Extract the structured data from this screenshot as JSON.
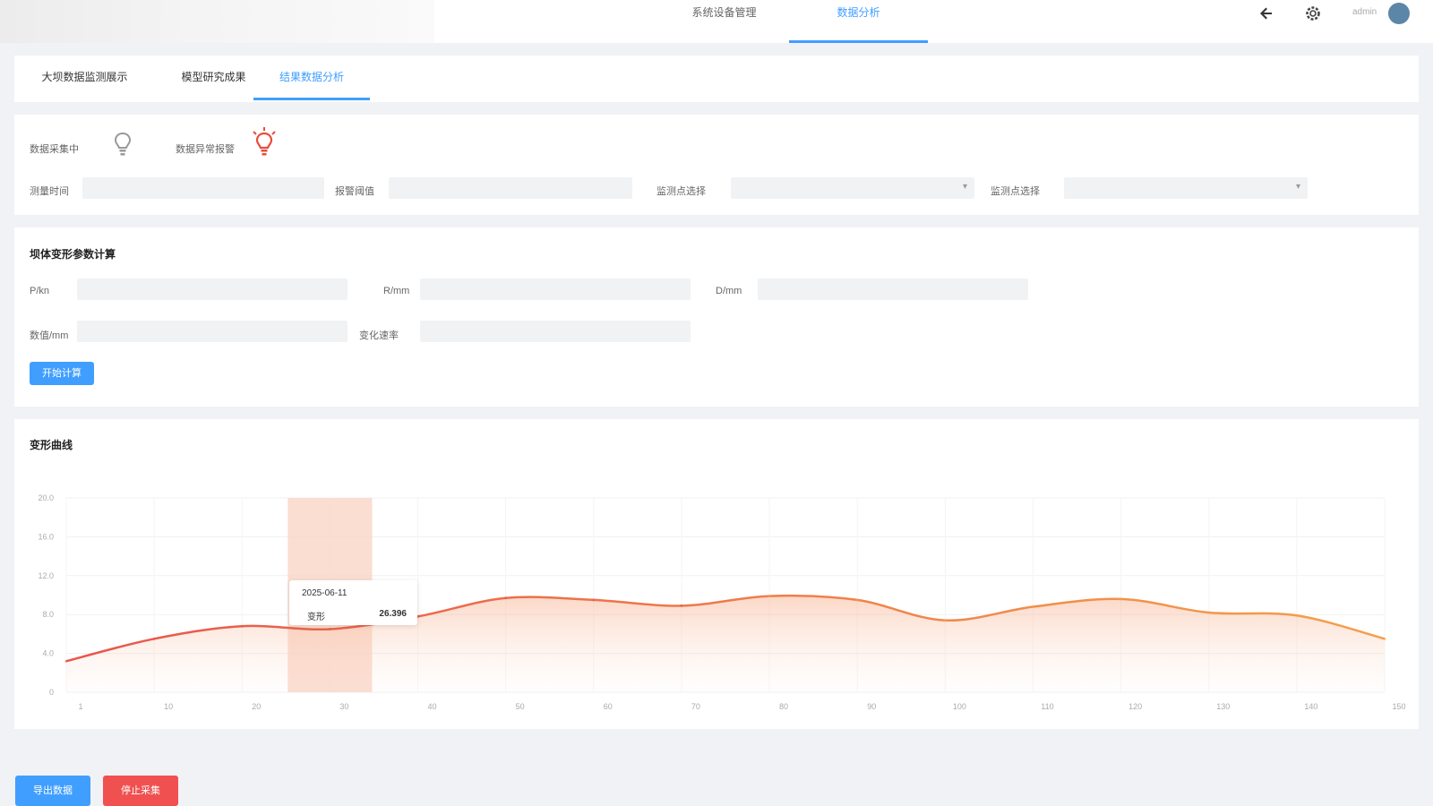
{
  "header": {
    "tabs": [
      {
        "label": "系统设备管理",
        "active": false
      },
      {
        "label": "数据分析",
        "active": true
      }
    ],
    "user_name": "admin"
  },
  "sub_tabs": [
    {
      "label": "大坝数据监测展示",
      "active": false
    },
    {
      "label": "模型研究成果",
      "active": false
    },
    {
      "label": "结果数据分析",
      "active": true
    }
  ],
  "status": {
    "indicators": [
      {
        "label": "数据采集中",
        "icon": "bulb-off-icon"
      },
      {
        "label": "数据异常报警",
        "icon": "bulb-alert-icon"
      }
    ],
    "fields": [
      {
        "label": "测量时间",
        "value": ""
      },
      {
        "label": "报警阈值",
        "value": ""
      },
      {
        "label": "监测点选择",
        "value": "",
        "type": "select"
      },
      {
        "label": "监测点选择",
        "value": "",
        "type": "select"
      }
    ]
  },
  "calc": {
    "title": "坝体变形参数计算",
    "fields_row1": [
      {
        "label": "P/kn",
        "value": ""
      },
      {
        "label": "R/mm",
        "value": ""
      },
      {
        "label": "D/mm",
        "value": ""
      }
    ],
    "fields_row2": [
      {
        "label": "数值/mm",
        "value": ""
      },
      {
        "label": "变化速率",
        "value": ""
      }
    ],
    "button": "开始计算"
  },
  "chart_title": "变形曲线",
  "chart_data": {
    "type": "area",
    "title": "变形曲线",
    "x": [
      "1",
      "10",
      "20",
      "30",
      "40",
      "50",
      "60",
      "70",
      "80",
      "90",
      "100",
      "110",
      "120",
      "130",
      "140",
      "150"
    ],
    "series": [
      {
        "name": "变形",
        "values": [
          3.2,
          5.5,
          6.8,
          6.5,
          7.8,
          9.7,
          9.5,
          8.9,
          9.9,
          9.5,
          7.4,
          8.8,
          9.6,
          8.2,
          7.9,
          5.5
        ]
      }
    ],
    "ylim": [
      0,
      20
    ],
    "yticks": [
      "0",
      "4.0",
      "8.0",
      "12.0",
      "16.0",
      "20.0"
    ],
    "highlight_index": 3,
    "tooltip": {
      "date": "2025-06-11",
      "name": "变形",
      "value": "26.396"
    },
    "line_color_start": "#e8554b",
    "line_color_end": "#f5a04b"
  },
  "footer": {
    "primary_button": "导出数据",
    "danger_button": "停止采集"
  }
}
